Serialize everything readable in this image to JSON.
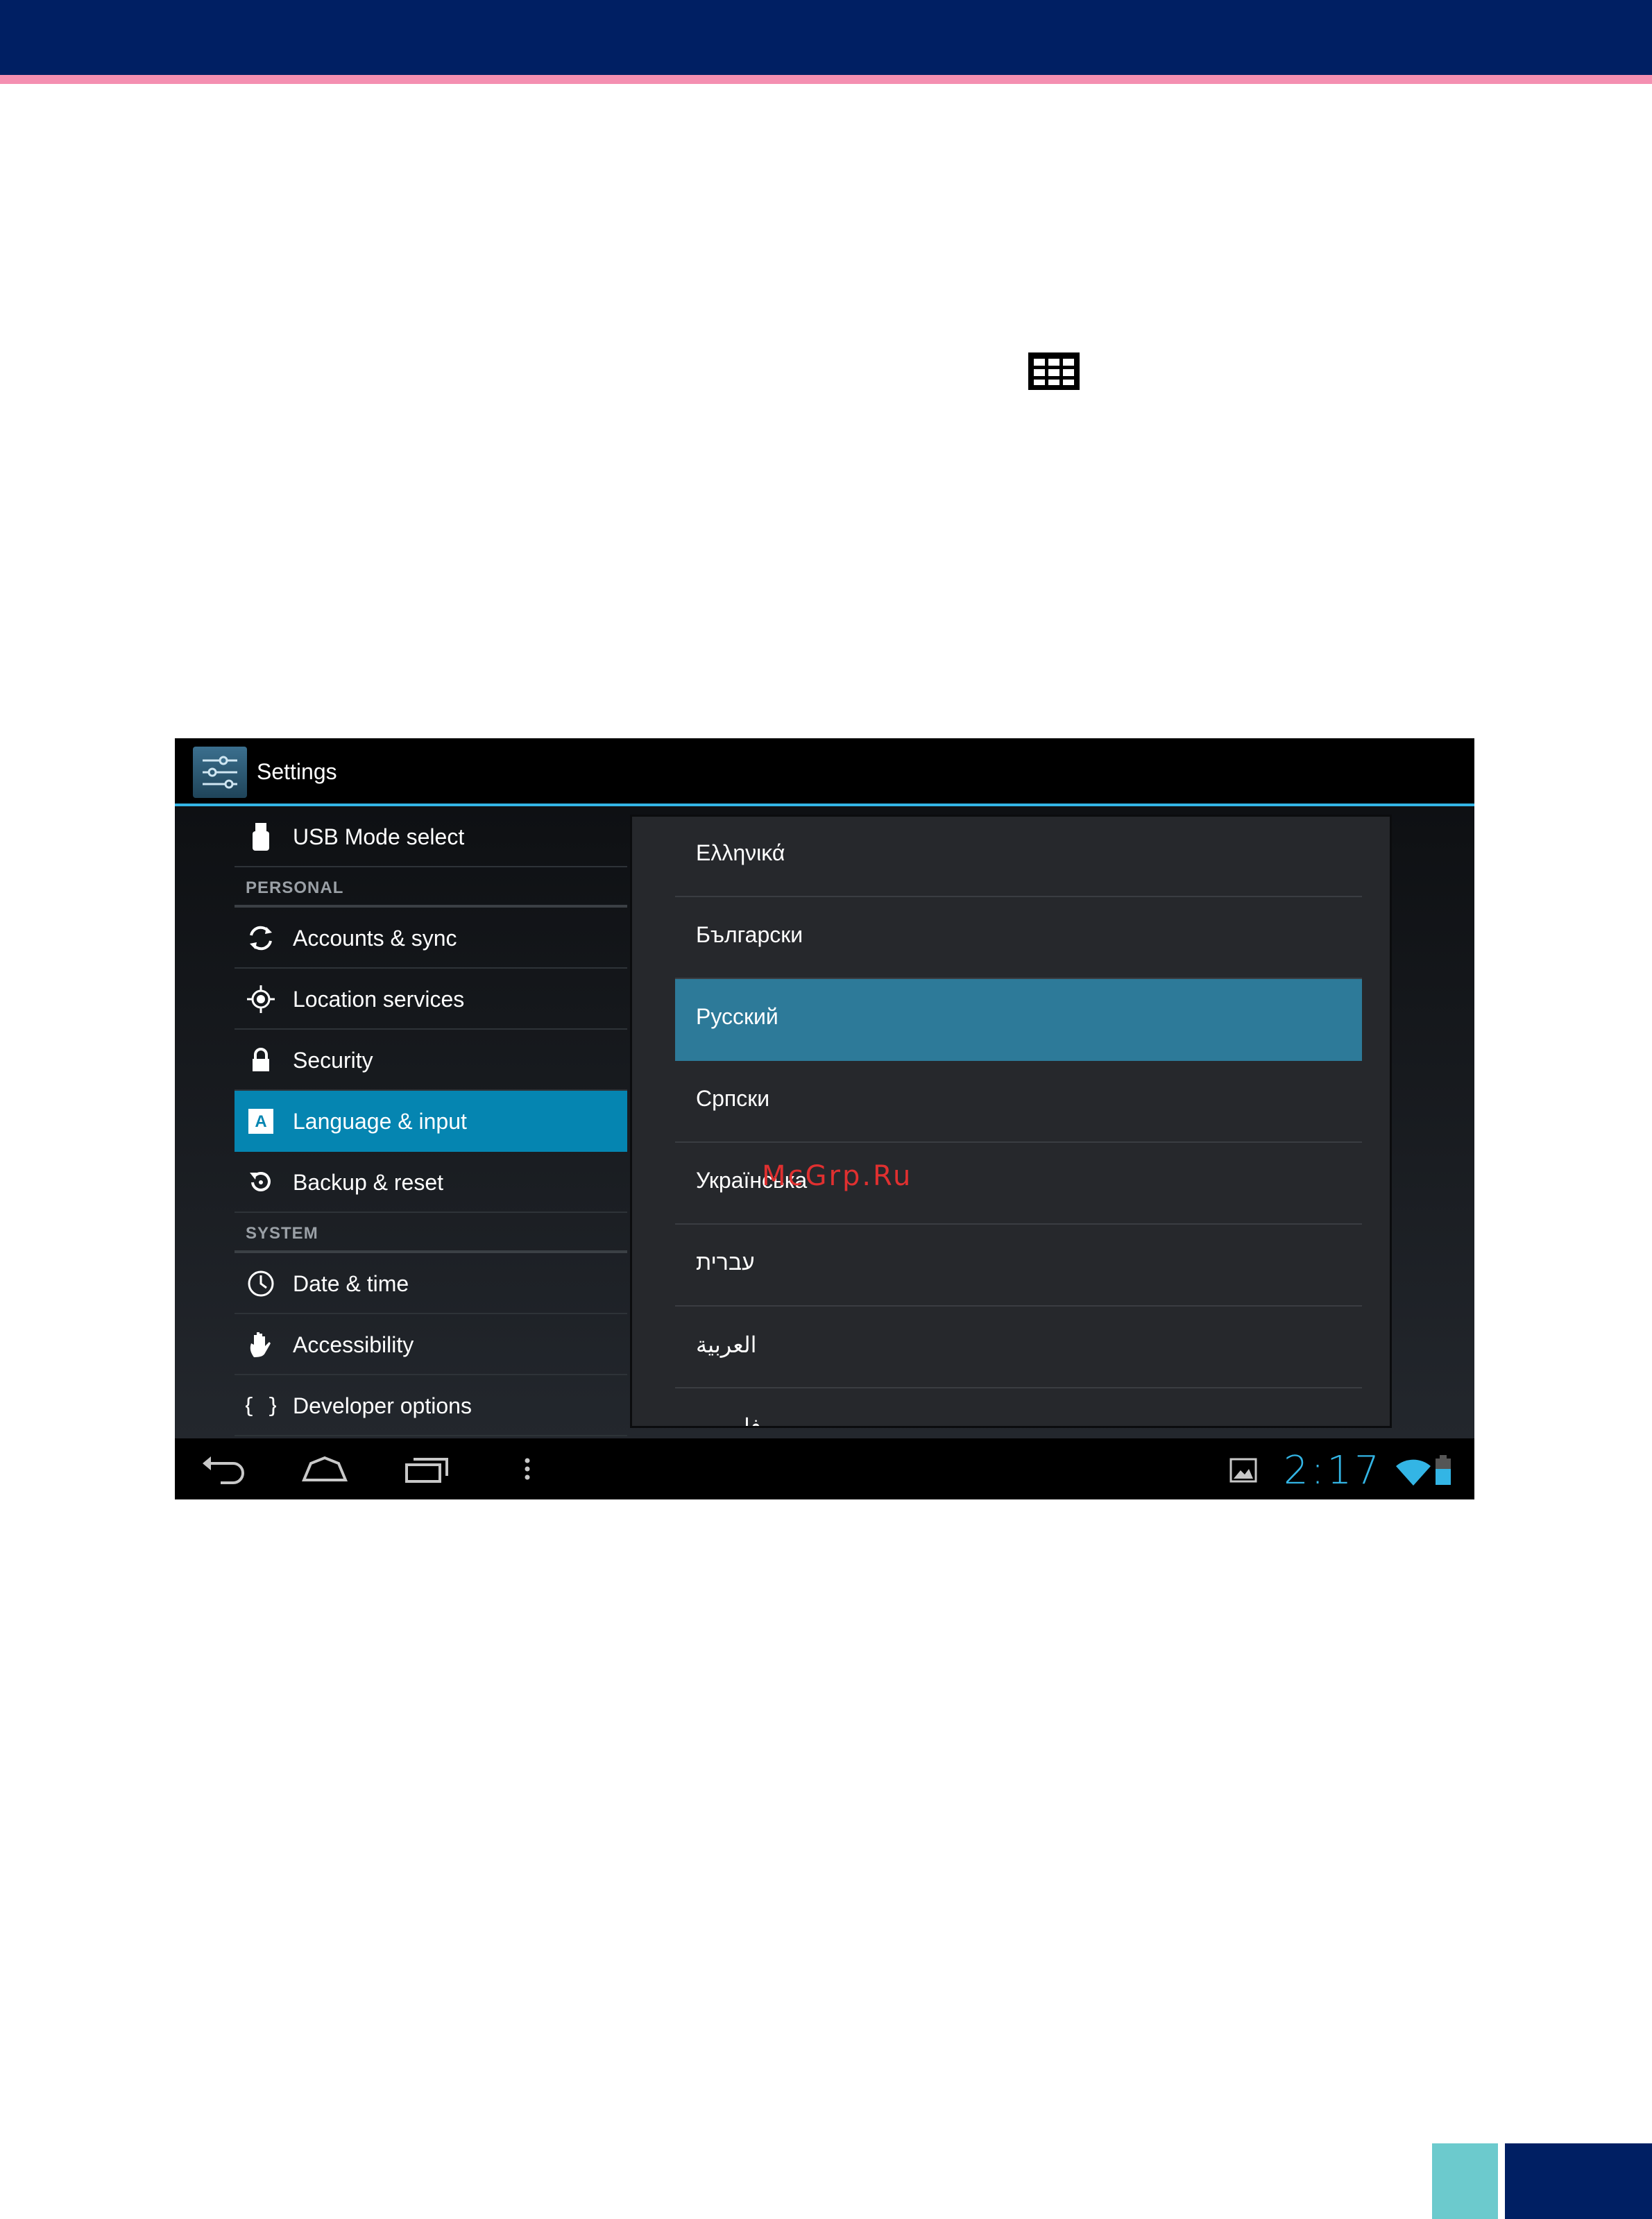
{
  "app": {
    "title": "Settings"
  },
  "menu": {
    "usb": "USB Mode select",
    "personal_header": "PERSONAL",
    "accounts": "Accounts & sync",
    "location": "Location services",
    "security": "Security",
    "language": "Language & input",
    "backup": "Backup & reset",
    "system_header": "SYSTEM",
    "datetime": "Date & time",
    "accessibility": "Accessibility",
    "developer": "Developer options"
  },
  "languages": {
    "items": [
      "Ελληνικά",
      "Български",
      "Русский",
      "Српски",
      "Українська",
      "עברית",
      "العربية",
      "فارسی"
    ],
    "selected": "Русский"
  },
  "watermark": "McGrp.Ru",
  "status": {
    "time": "2:17"
  },
  "colors": {
    "accent": "#33b5e5",
    "selected_row": "#0585b1",
    "dialog_selected": "#2d7a99",
    "brand_dark": "#001f63",
    "brand_pink": "#f48fb1",
    "brand_teal": "#6ccacd"
  }
}
